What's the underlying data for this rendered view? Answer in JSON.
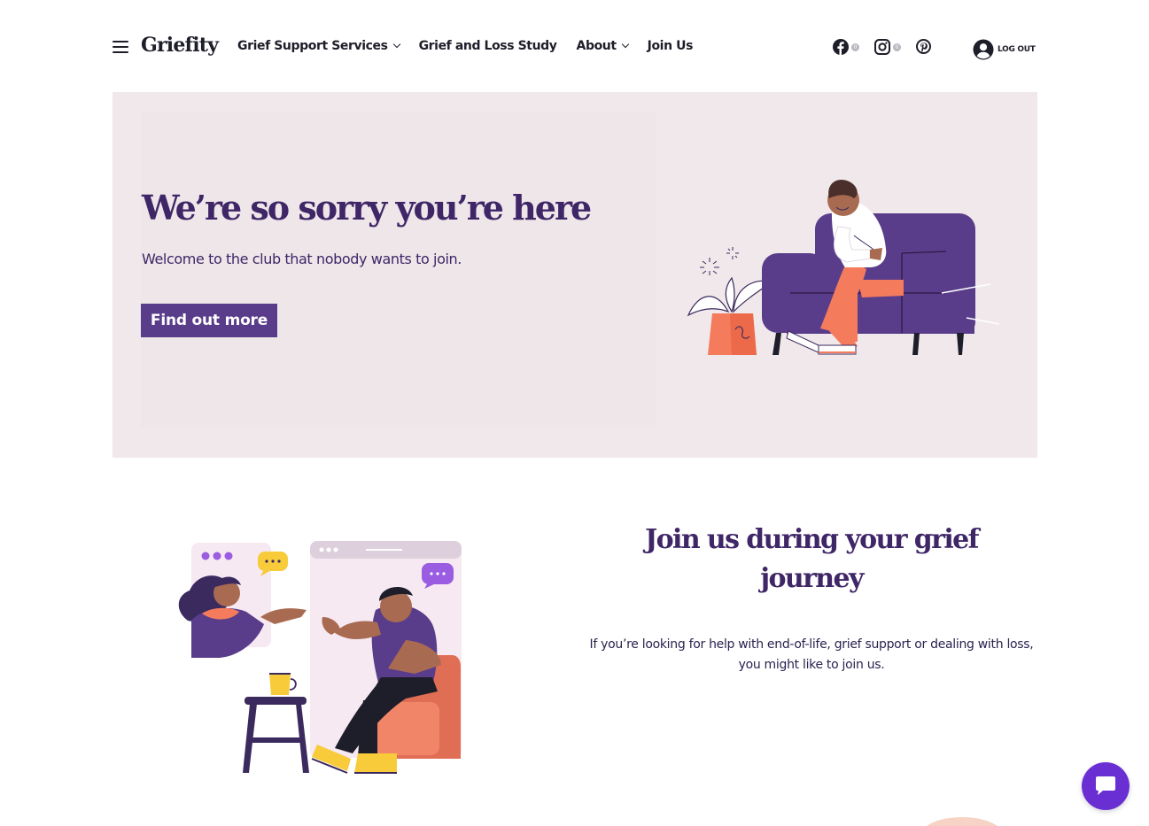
{
  "header": {
    "logo": "Griefity",
    "nav": [
      {
        "label": "Grief Support Services",
        "has_dropdown": true
      },
      {
        "label": "Grief and Loss Study",
        "has_dropdown": false
      },
      {
        "label": "About",
        "has_dropdown": true
      },
      {
        "label": "Join Us",
        "has_dropdown": false
      }
    ],
    "social": [
      {
        "icon": "facebook-icon",
        "count": "0"
      },
      {
        "icon": "instagram-icon",
        "count": "0"
      },
      {
        "icon": "pinterest-icon"
      }
    ],
    "logout_label": "LOG OUT",
    "user_icon": "user-circle-icon",
    "menu_icon": "hamburger-icon"
  },
  "hero": {
    "title": "We’re so sorry you’re here",
    "subtitle": "Welcome to the club that nobody wants to join.",
    "cta_label": "Find out more",
    "background_color": "#f1e8eb",
    "accent_color": "#5a3d8a"
  },
  "join": {
    "title": "Join us during your grief journey",
    "text": "If you’re looking for help with end-of-life, grief support or dealing with loss, you might like to join us."
  },
  "chat": {
    "icon": "chat-bubble-icon",
    "color": "#6a2fd3"
  }
}
